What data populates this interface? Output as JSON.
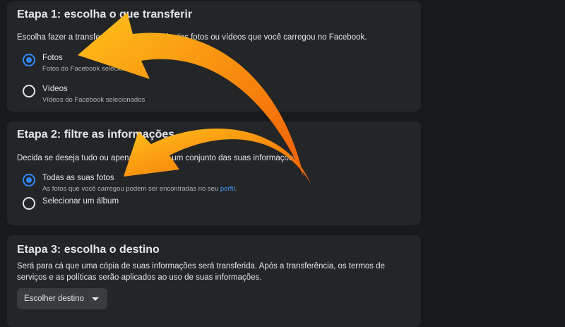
{
  "step1": {
    "title": "Etapa 1: escolha o que transferir",
    "description": "Escolha fazer a transferência de uma cópia das fotos ou vídeos que você carregou no Facebook.",
    "options": [
      {
        "label": "Fotos",
        "sub": "Fotos do Facebook selecionadas",
        "selected": true
      },
      {
        "label": "Vídeos",
        "sub": "Vídeos do Facebook selecionados",
        "selected": false
      }
    ]
  },
  "step2": {
    "title": "Etapa 2: filtre as informações",
    "description": "Decida se deseja tudo ou apenas parte de um conjunto das suas informações",
    "options": [
      {
        "label": "Todas as suas fotos",
        "sub": "As fotos que você carregou podem ser encontradas no seu",
        "link": "perfil",
        "selected": true
      },
      {
        "label": "Selecionar um álbum",
        "selected": false
      }
    ]
  },
  "step3": {
    "title": "Etapa 3: escolha o destino",
    "description_line1": "Será para cá que uma cópia de suas informações será transferida. Após a transferência, os termos de",
    "description_line2": "serviços e as políticas serão aplicados ao uso de suas informações.",
    "button_label": "Escolher destino"
  },
  "colors": {
    "background": "#18191a",
    "card": "#242526",
    "accent": "#2d88ff",
    "arrow": "#ff9f1a"
  },
  "overlay": {
    "arrows": [
      "curved-arrow-icon",
      "curved-arrow-icon"
    ]
  }
}
